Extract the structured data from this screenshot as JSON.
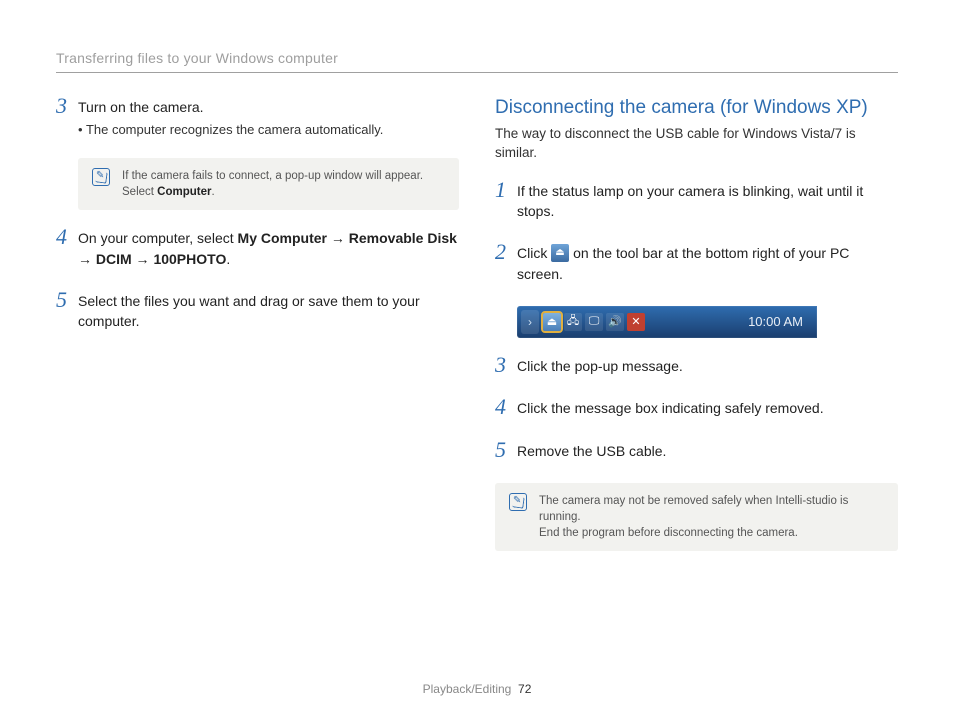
{
  "breadcrumb": "Transferring files to your Windows computer",
  "left": {
    "steps": [
      {
        "n": "3",
        "lead": "Turn on the camera.",
        "bullet": "The computer recognizes the camera automatically."
      },
      {
        "n": "4",
        "html": "On your computer, select <b>My Computer</b> → <b>Removable Disk</b> → <b>DCIM</b> → <b>100PHOTO</b>."
      },
      {
        "n": "5",
        "lead": "Select the files you want and drag or save them to your computer."
      }
    ],
    "note": {
      "pre": "If the camera fails to connect, a pop-up window will appear. Select ",
      "bold": "Computer",
      "post": "."
    }
  },
  "right": {
    "heading": "Disconnecting the camera (for Windows XP)",
    "sub": "The way to disconnect the USB cable for Windows Vista/7 is similar.",
    "steps": [
      {
        "n": "1",
        "lead": "If the status lamp on your camera is blinking, wait until it stops."
      },
      {
        "n": "2",
        "pre": "Click ",
        "post": " on the tool bar at the bottom right of your PC screen."
      },
      {
        "n": "3",
        "lead": "Click the pop-up message."
      },
      {
        "n": "4",
        "lead": "Click the message box indicating safely removed."
      },
      {
        "n": "5",
        "lead": "Remove the USB cable."
      }
    ],
    "taskbar_time": "10:00 AM",
    "note": {
      "l1": "The camera may not be removed safely when Intelli-studio is running.",
      "l2": "End the program before disconnecting the camera."
    }
  },
  "footer": {
    "section": "Playback/Editing",
    "page": "72"
  }
}
